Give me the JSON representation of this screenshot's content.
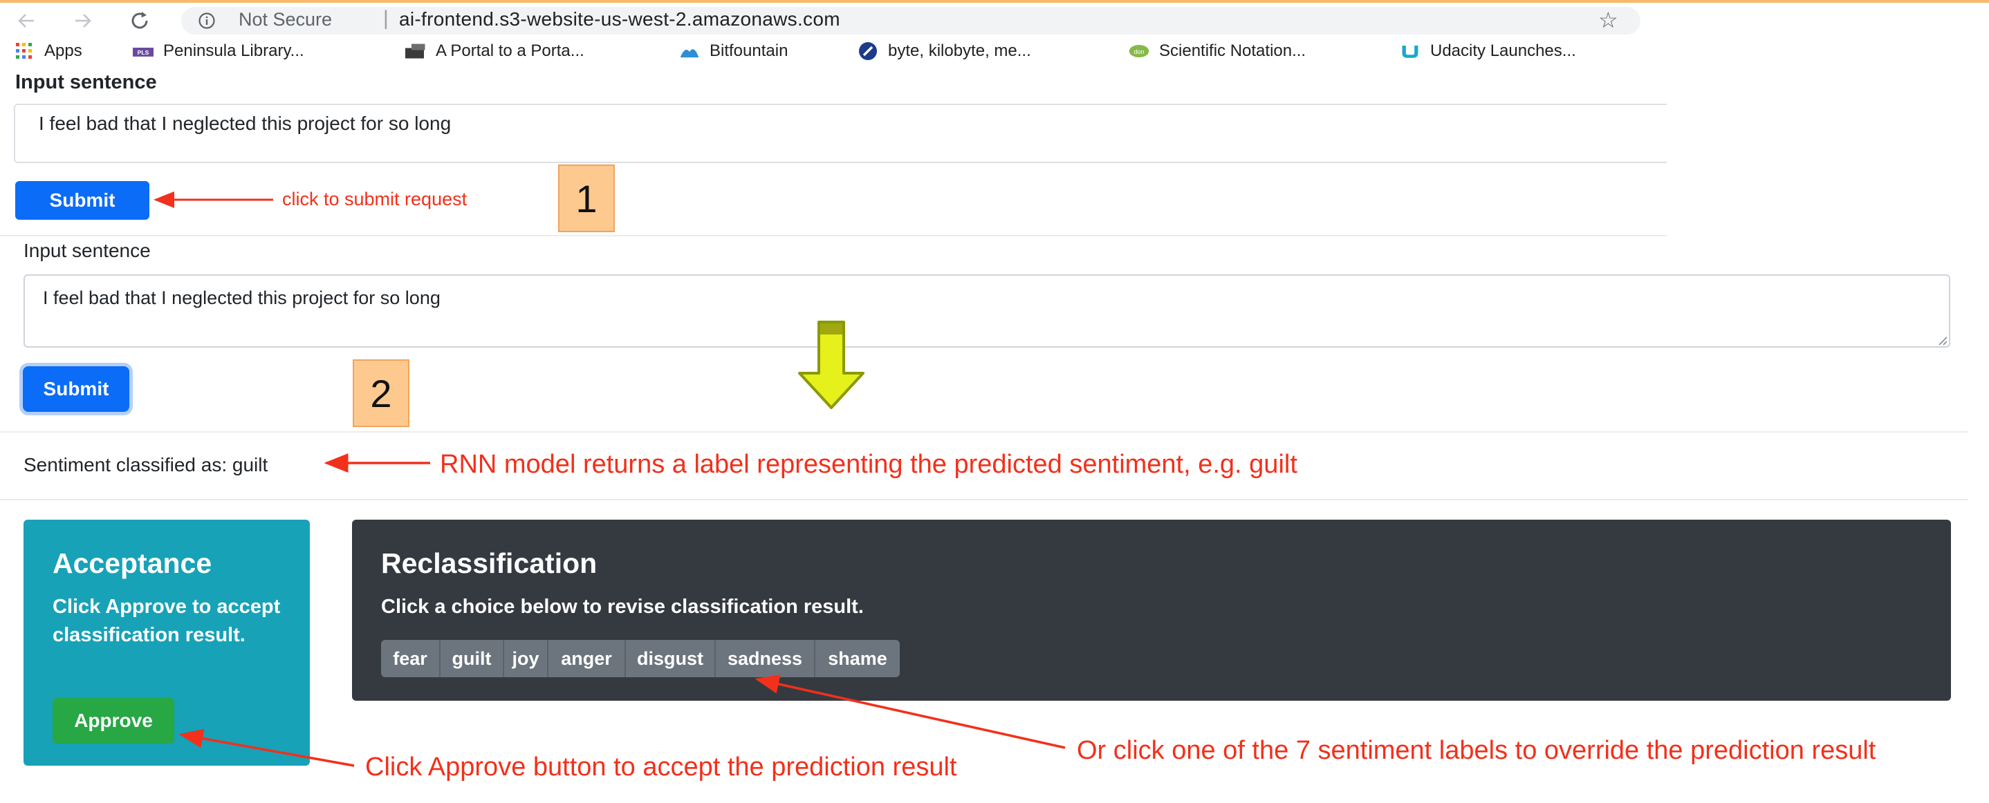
{
  "browser": {
    "security_label": "Not Secure",
    "url_separator": "|",
    "url": "ai-frontend.s3-website-us-west-2.amazonaws.com",
    "bookmarks": [
      {
        "label": "Apps",
        "icon": "apps-grid-icon"
      },
      {
        "label": "Peninsula Library...",
        "icon": "pls-logo-icon"
      },
      {
        "label": "A Portal to a Porta...",
        "icon": "portal-icon"
      },
      {
        "label": "Bitfountain",
        "icon": "bitfountain-icon"
      },
      {
        "label": "byte, kilobyte, me...",
        "icon": "byte-icon"
      },
      {
        "label": "Scientific Notation...",
        "icon": "scientific-notation-icon"
      },
      {
        "label": "Udacity Launches...",
        "icon": "udacity-icon"
      }
    ]
  },
  "section1": {
    "label": "Input sentence",
    "input_value": "I feel bad that I neglected this project for so long",
    "submit_label": "Submit",
    "note": "click to submit request",
    "step": "1"
  },
  "section2": {
    "label": "Input sentence",
    "input_value": "I feel bad that I neglected this project for so long",
    "submit_label": "Submit",
    "step": "2"
  },
  "result": {
    "sentiment_text": "Sentiment classified as: guilt"
  },
  "annotations": {
    "rnn": "RNN model returns a label representing the predicted sentiment, e.g. guilt",
    "approve": "Click Approve button to accept the prediction result",
    "override": "Or click one of the 7 sentiment labels to override the prediction result"
  },
  "acceptance": {
    "title": "Acceptance",
    "body": "Click Approve to accept classification result.",
    "button_label": "Approve"
  },
  "reclassification": {
    "title": "Reclassification",
    "body": "Click a choice below to revise classification result.",
    "labels": [
      "fear",
      "guilt",
      "joy",
      "anger",
      "disgust",
      "sadness",
      "shame"
    ]
  },
  "colors": {
    "primary": "#0b6cf7",
    "acceptance_bg": "#17a2b8",
    "approve_green": "#28a745",
    "reclass_bg": "#343a40",
    "chip_gray": "#6c757d",
    "annotation_red": "#f2301b",
    "step_box": "#fdc98f",
    "arrow_yellow": "#e6f01a"
  }
}
